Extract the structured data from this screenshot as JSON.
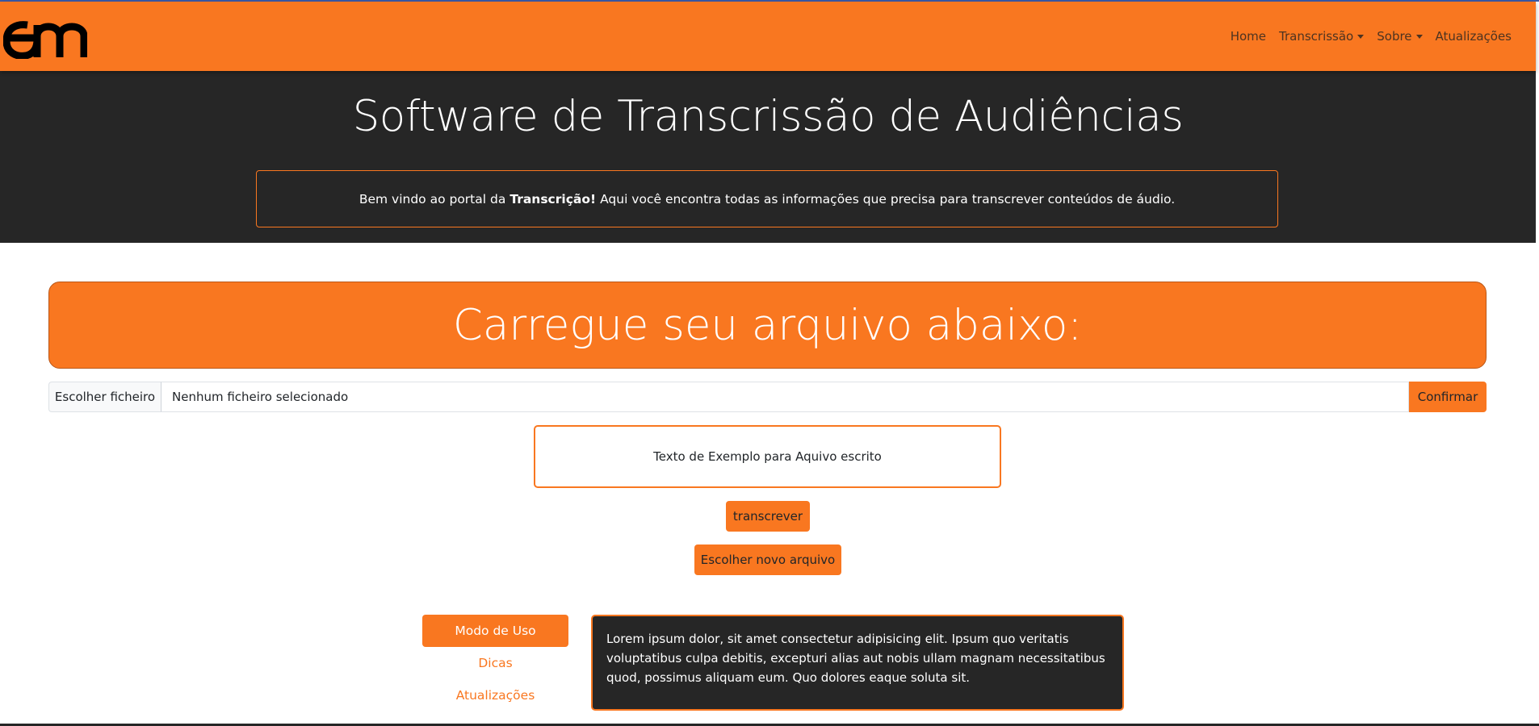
{
  "colors": {
    "brand_orange": "#f97720",
    "dark_bg": "#262626",
    "white": "#ffffff"
  },
  "navbar": {
    "logo_icon": "am-logo",
    "items": [
      {
        "label": "Home",
        "dropdown": false
      },
      {
        "label": "Transcrissão",
        "dropdown": true
      },
      {
        "label": "Sobre",
        "dropdown": true
      },
      {
        "label": "Atualizações",
        "dropdown": false
      }
    ]
  },
  "hero": {
    "title": "Software de Transcrissão de Audiências",
    "welcome_prefix": "Bem vindo ao portal da",
    "welcome_bold": "Transcrição!",
    "welcome_suffix": "Aqui você encontra todas as informações que precisa para transcrever conteúdos de áudio."
  },
  "upload": {
    "banner_title": "Carregue seu arquivo abaixo:",
    "choose_label": "Escolher ficheiro",
    "file_status": "Nenhum ficheiro selecionado",
    "confirm_label": "Confirmar"
  },
  "example_text": "Texto de Exemplo para Aquivo escrito",
  "buttons": {
    "transcribe_label": "transcrever",
    "new_file_label": "Escolher novo arquivo"
  },
  "side_menu": [
    {
      "label": "Modo de Uso",
      "active": true
    },
    {
      "label": "Dicas",
      "active": false
    },
    {
      "label": "Atualizações",
      "active": false
    }
  ],
  "info_text": "Lorem ipsum dolor, sit amet consectetur adipisicing elit. Ipsum quo veritatis voluptatibus culpa debitis, excepturi alias aut nobis ullam magnam necessitatibus quod, possimus aliquam eum. Quo dolores eaque soluta sit."
}
